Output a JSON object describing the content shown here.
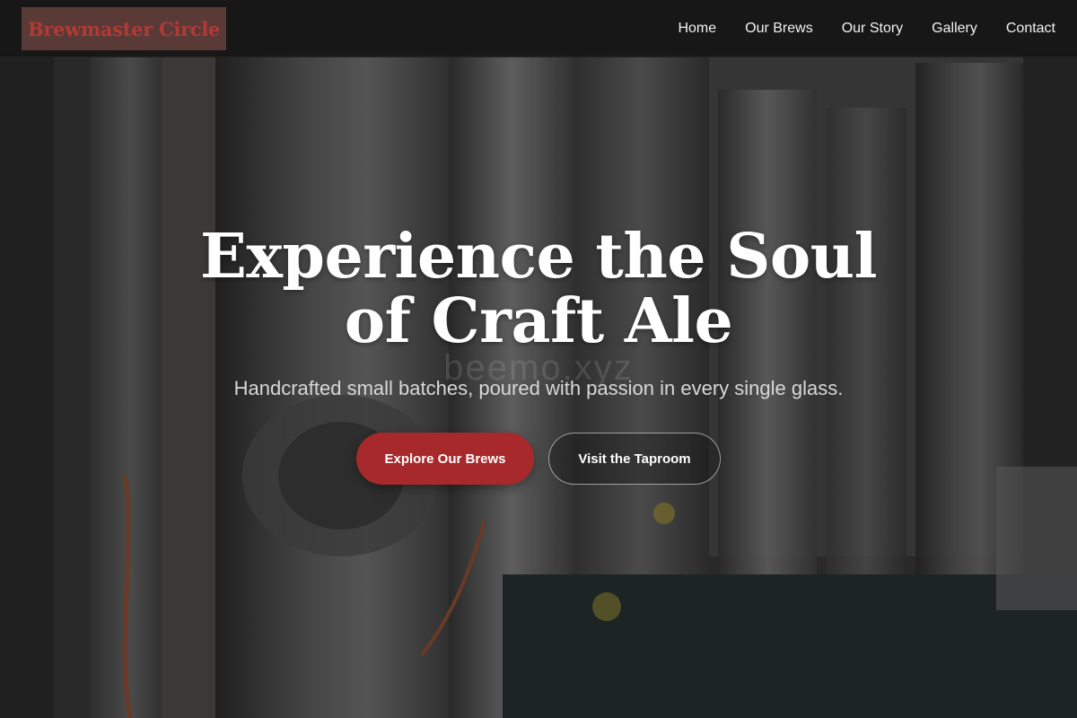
{
  "header": {
    "logo_text": "Brewmaster Circle",
    "nav": [
      {
        "label": "Home"
      },
      {
        "label": "Our Brews"
      },
      {
        "label": "Our Story"
      },
      {
        "label": "Gallery"
      },
      {
        "label": "Contact"
      }
    ]
  },
  "hero": {
    "title": "Experience the Soul of Craft Ale",
    "watermark": "beemo.xyz",
    "subtitle": "Handcrafted small batches, poured with passion in every single glass.",
    "primary_button": "Explore Our Brews",
    "secondary_button": "Visit the Taproom"
  },
  "colors": {
    "accent": "#a8292b",
    "logo_bg": "#5a3a36",
    "logo_text": "#b03a36",
    "header_bg": "#161616"
  }
}
